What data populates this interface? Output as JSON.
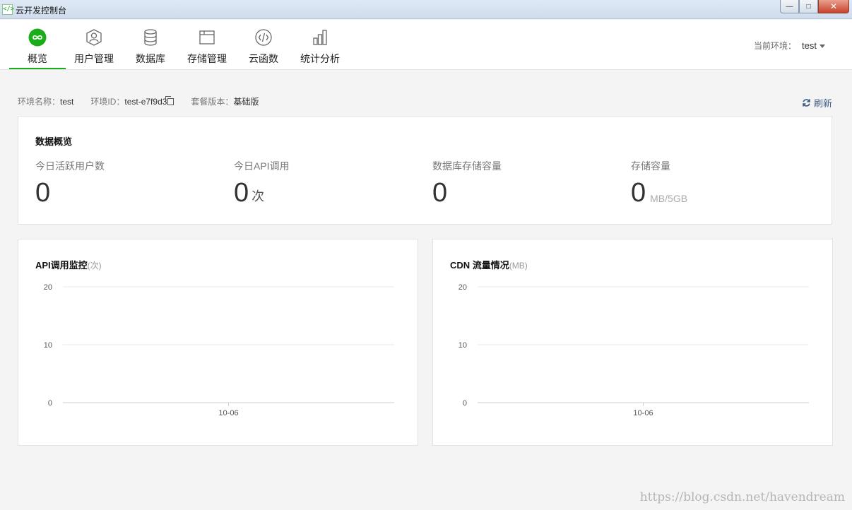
{
  "window": {
    "title": "云开发控制台",
    "icon": "code-bracket-icon"
  },
  "nav": {
    "items": [
      {
        "label": "概览",
        "icon": "infinity-icon",
        "active": true
      },
      {
        "label": "用户管理",
        "icon": "user-icon"
      },
      {
        "label": "数据库",
        "icon": "database-icon"
      },
      {
        "label": "存储管理",
        "icon": "folder-icon"
      },
      {
        "label": "云函数",
        "icon": "function-icon"
      },
      {
        "label": "统计分析",
        "icon": "bar-chart-icon"
      }
    ],
    "env_label": "当前环境：",
    "env_value": "test"
  },
  "info": {
    "env_name_label": "环境名称：",
    "env_name": "test",
    "env_id_label": "环境ID：",
    "env_id": "test-e7f9d3",
    "plan_label": "套餐版本：",
    "plan": "基础版",
    "refresh_label": "刷新"
  },
  "overview": {
    "title": "数据概览",
    "metrics": [
      {
        "label": "今日活跃用户数",
        "value": "0",
        "unit": ""
      },
      {
        "label": "今日API调用",
        "value": "0",
        "unit": "次"
      },
      {
        "label": "数据库存储容量",
        "value": "0",
        "unit": ""
      },
      {
        "label": "存储容量",
        "value": "0",
        "unit": "MB/5GB"
      }
    ]
  },
  "charts": {
    "api": {
      "title": "API调用监控",
      "unit": "(次)"
    },
    "cdn": {
      "title": "CDN 流量情况",
      "unit": "(MB)"
    }
  },
  "chart_data": [
    {
      "type": "line",
      "title": "API调用监控(次)",
      "x": [
        "10-06"
      ],
      "series": [
        {
          "values": []
        }
      ],
      "yticks": [
        0,
        10,
        20
      ],
      "ylim": [
        0,
        20
      ],
      "grid": true
    },
    {
      "type": "line",
      "title": "CDN 流量情况(MB)",
      "x": [
        "10-06"
      ],
      "series": [
        {
          "values": []
        }
      ],
      "yticks": [
        0,
        10,
        20
      ],
      "ylim": [
        0,
        20
      ],
      "grid": true
    }
  ],
  "watermark": "https://blog.csdn.net/havendream"
}
